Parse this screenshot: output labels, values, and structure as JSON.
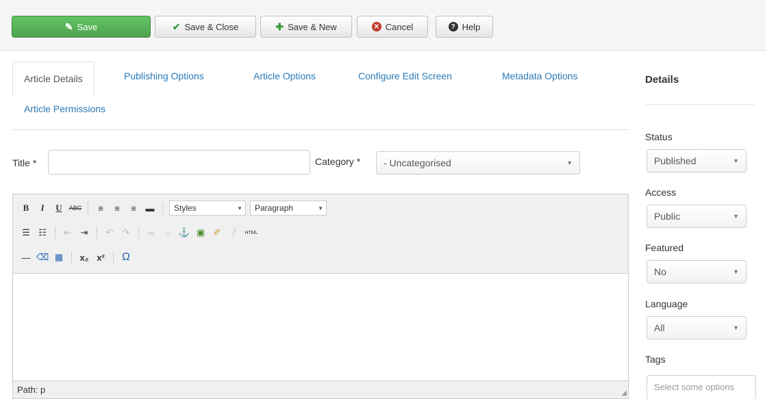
{
  "toolbar": {
    "save": "Save",
    "save_close": "Save & Close",
    "save_new": "Save & New",
    "cancel": "Cancel",
    "help": "Help"
  },
  "tabs": [
    {
      "label": "Article Details",
      "active": true
    },
    {
      "label": "Publishing Options"
    },
    {
      "label": "Article Options"
    },
    {
      "label": "Configure Edit Screen"
    },
    {
      "label": "Metadata Options"
    },
    {
      "label": "Article Permissions"
    }
  ],
  "form": {
    "title_label": "Title *",
    "title_value": "",
    "category_label": "Category *",
    "category_value": "- Uncategorised"
  },
  "editor": {
    "styles_label": "Styles",
    "format_label": "Paragraph",
    "path_label": "Path: p",
    "html_button": "HTML"
  },
  "sidebar": {
    "title": "Details",
    "status_label": "Status",
    "status_value": "Published",
    "access_label": "Access",
    "access_value": "Public",
    "featured_label": "Featured",
    "featured_value": "No",
    "language_label": "Language",
    "language_value": "All",
    "tags_label": "Tags",
    "tags_placeholder": "Select some options"
  },
  "colors": {
    "save_button": "#51a351",
    "link": "#2a7ab8",
    "cancel_icon": "#c0392b"
  }
}
